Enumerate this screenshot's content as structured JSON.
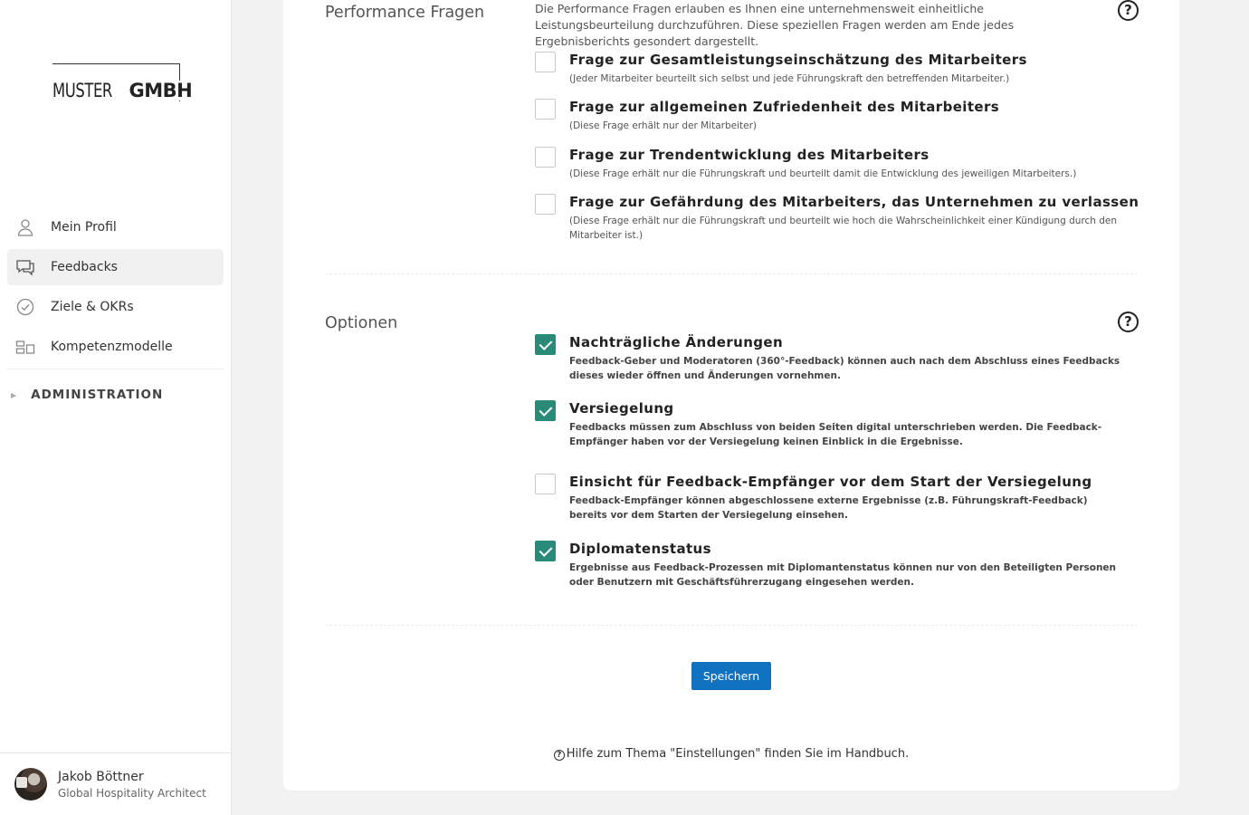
{
  "brand": {
    "logo_thin": "MUSTER",
    "logo_bold": "GMBH"
  },
  "sidebar": {
    "items": [
      {
        "label": "Mein Profil",
        "icon": "user-icon",
        "active": false
      },
      {
        "label": "Feedbacks",
        "icon": "chat-bubbles-icon",
        "active": true
      },
      {
        "label": "Ziele & OKRs",
        "icon": "check-circle-icon",
        "active": false
      },
      {
        "label": "Kompetenzmodelle",
        "icon": "blocks-icon",
        "active": false
      }
    ],
    "admin_label": "ADMINISTRATION"
  },
  "user": {
    "name": "Jakob Böttner",
    "role": "Global Hospitality Architect"
  },
  "performance": {
    "title": "Performance Fragen",
    "description": "Die Performance Fragen erlauben es Ihnen eine unternehmensweit einheitliche Leistungsbeurteilung durchzuführen. Diese speziellen Fragen werden am Ende jedes Ergebnisberichts gesondert dargestellt.",
    "questions": [
      {
        "title": "Frage zur Gesamtleistungseinschätzung des Mitarbeiters",
        "subtitle": "(Jeder Mitarbeiter beurteilt sich selbst und jede Führungskraft den betreffenden Mitarbeiter.)",
        "checked": false
      },
      {
        "title": "Frage zur allgemeinen Zufriedenheit des Mitarbeiters",
        "subtitle": "(Diese Frage erhält nur der Mitarbeiter)",
        "checked": false
      },
      {
        "title": "Frage zur Trendentwicklung des Mitarbeiters",
        "subtitle": "(Diese Frage erhält nur die Führungskraft und beurteilt damit die Entwicklung des jeweiligen Mitarbeiters.)",
        "checked": false
      },
      {
        "title": "Frage zur Gefährdung des Mitarbeiters, das Unternehmen zu verlassen",
        "subtitle": "(Diese Frage erhält nur die Führungskraft und beurteilt wie hoch die Wahrscheinlichkeit einer Kündigung durch den Mitarbeiter ist.)",
        "checked": false
      }
    ]
  },
  "options": {
    "title": "Optionen",
    "items": [
      {
        "title": "Nachträgliche Änderungen",
        "subtitle": "Feedback-Geber und Moderatoren (360°-Feedback) können auch nach dem Abschluss eines Feedbacks dieses wieder öffnen und Änderungen vornehmen.",
        "checked": true
      },
      {
        "title": "Versiegelung",
        "subtitle": "Feedbacks müssen zum Abschluss von beiden Seiten digital unterschrieben werden. Die Feedback-Empfänger haben vor der Versiegelung keinen Einblick in die Ergebnisse.",
        "checked": true
      },
      {
        "title": "Einsicht für Feedback-Empfänger vor dem Start der Versiegelung",
        "subtitle": "Feedback-Empfänger können abgeschlossene externe Ergebnisse (z.B. Führungskraft-Feedback) bereits vor dem Starten der Versiegelung einsehen.",
        "checked": false
      },
      {
        "title": "Diplomatenstatus",
        "subtitle": "Ergebnisse aus Feedback-Prozessen mit Diplomantenstatus können nur von den Beteiligten Personen oder Benutzern mit Geschäftsführerzugang eingesehen werden.",
        "checked": true
      }
    ]
  },
  "actions": {
    "save_label": "Speichern"
  },
  "footer": {
    "help_text": "Hilfe zum Thema \"Einstellungen\" finden Sie im Handbuch."
  },
  "colors": {
    "accent": "#2a8a78",
    "primary_button": "#0f73c2"
  }
}
